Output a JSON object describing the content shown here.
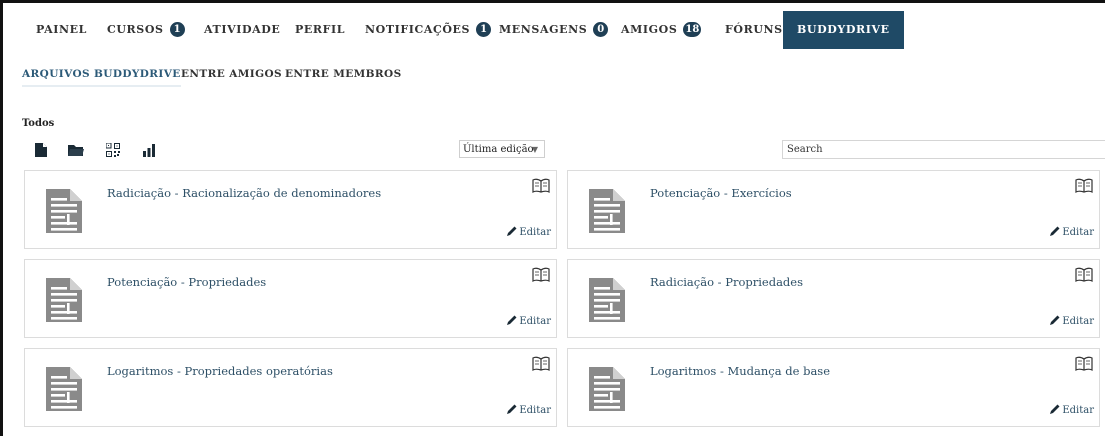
{
  "nav": {
    "items": [
      {
        "label": "PAINEL"
      },
      {
        "label": "CURSOS",
        "badge": "1"
      },
      {
        "label": "ATIVIDADE"
      },
      {
        "label": "PERFIL"
      },
      {
        "label": "NOTIFICAÇÕES",
        "badge": "1"
      },
      {
        "label": "MENSAGENS",
        "badge": "0"
      },
      {
        "label": "AMIGOS",
        "badge": "18"
      },
      {
        "label": "FÓRUNS"
      },
      {
        "label": "BUDDYDRIVE",
        "active": true
      }
    ]
  },
  "subnav": {
    "items": [
      {
        "label": "ARQUIVOS BUDDYDRIVE",
        "active": true
      },
      {
        "label": "ENTRE AMIGOS"
      },
      {
        "label": "ENTRE MEMBROS"
      }
    ]
  },
  "filter": {
    "label": "Todos"
  },
  "toolbar": {
    "icons": [
      "new-file-icon",
      "folder-icon",
      "qr-code-icon",
      "stats-icon"
    ]
  },
  "sort": {
    "selected": "Última edição"
  },
  "search": {
    "placeholder": "Search"
  },
  "files": [
    {
      "title": "Radiciação - Racionalização de denominadores",
      "edit_label": "Editar"
    },
    {
      "title": "Potenciação - Exercícios",
      "edit_label": "Editar"
    },
    {
      "title": "Potenciação - Propriedades",
      "edit_label": "Editar"
    },
    {
      "title": "Radiciação - Propriedades",
      "edit_label": "Editar"
    },
    {
      "title": "Logaritmos - Propriedades operatórias",
      "edit_label": "Editar"
    },
    {
      "title": "Logaritmos - Mudança de base",
      "edit_label": "Editar"
    }
  ],
  "colors": {
    "accent": "#1f4a66",
    "badge": "#1f3f55",
    "link": "#2d4f66",
    "icon": "#888888"
  }
}
